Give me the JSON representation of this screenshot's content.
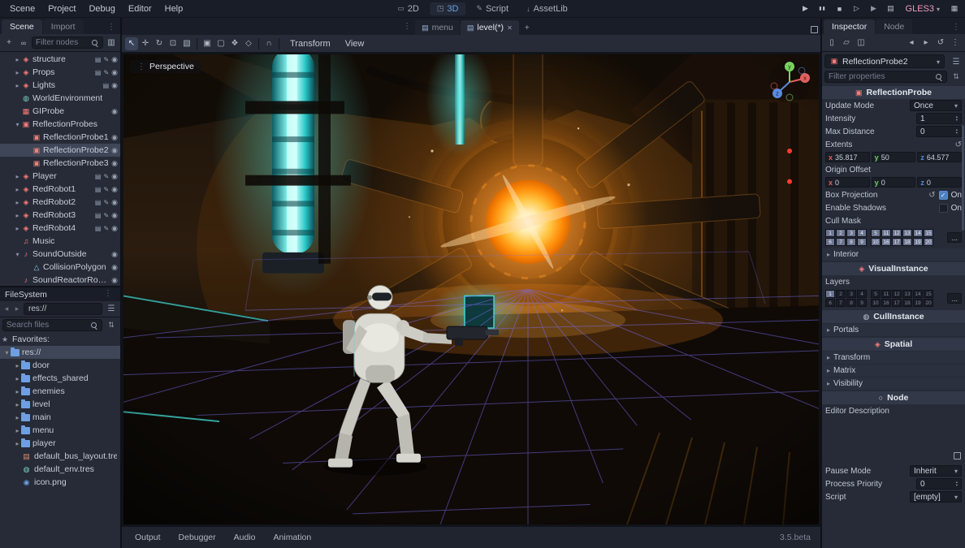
{
  "menubar": {
    "menus": [
      "Scene",
      "Project",
      "Debug",
      "Editor",
      "Help"
    ],
    "workspaces": [
      {
        "label": "2D",
        "icon": "ws-2d"
      },
      {
        "label": "3D",
        "icon": "ws-3d",
        "active": true
      },
      {
        "label": "Script",
        "icon": "ws-script"
      },
      {
        "label": "AssetLib",
        "icon": "ws-asset"
      }
    ],
    "renderer": "GLES3"
  },
  "scene_dock": {
    "tabs": [
      {
        "label": "Scene",
        "active": true
      },
      {
        "label": "Import",
        "active": false
      }
    ],
    "filter_placeholder": "Filter nodes",
    "nodes": [
      {
        "label": "structure",
        "indent": 1,
        "expand": "right",
        "icon": "ic-spatial",
        "scene_badge": true,
        "script_badge": true,
        "eye": true
      },
      {
        "label": "Props",
        "indent": 1,
        "expand": "right",
        "icon": "ic-spatial",
        "scene_badge": true,
        "script_badge": true,
        "eye": true
      },
      {
        "label": "Lights",
        "indent": 1,
        "expand": "right",
        "icon": "ic-spatial",
        "scene_badge": true,
        "eye": true
      },
      {
        "label": "WorldEnvironment",
        "indent": 1,
        "icon": "ic-world"
      },
      {
        "label": "GIProbe",
        "indent": 1,
        "icon": "ic-giprobe",
        "eye": true
      },
      {
        "label": "ReflectionProbes",
        "indent": 1,
        "expand": "down",
        "icon": "ic-probe"
      },
      {
        "label": "ReflectionProbe1",
        "indent": 2,
        "icon": "ic-probe",
        "eye": true
      },
      {
        "label": "ReflectionProbe2",
        "indent": 2,
        "icon": "ic-probe",
        "eye": true,
        "selected": true
      },
      {
        "label": "ReflectionProbe3",
        "indent": 2,
        "icon": "ic-probe",
        "eye": true
      },
      {
        "label": "Player",
        "indent": 1,
        "expand": "right",
        "icon": "ic-spatial",
        "scene_badge": true,
        "script_badge": true,
        "eye": true
      },
      {
        "label": "RedRobot1",
        "indent": 1,
        "expand": "right",
        "icon": "ic-spatial",
        "scene_badge": true,
        "script_badge": true,
        "eye": true
      },
      {
        "label": "RedRobot2",
        "indent": 1,
        "expand": "right",
        "icon": "ic-spatial",
        "scene_badge": true,
        "script_badge": true,
        "eye": true
      },
      {
        "label": "RedRobot3",
        "indent": 1,
        "expand": "right",
        "icon": "ic-spatial",
        "scene_badge": true,
        "script_badge": true,
        "eye": true
      },
      {
        "label": "RedRobot4",
        "indent": 1,
        "expand": "right",
        "icon": "ic-spatial",
        "scene_badge": true,
        "script_badge": true,
        "eye": true
      },
      {
        "label": "Music",
        "indent": 1,
        "icon": "ic-music"
      },
      {
        "label": "SoundOutside",
        "indent": 1,
        "expand": "down",
        "icon": "ic-sound",
        "eye": true
      },
      {
        "label": "CollisionPolygon",
        "indent": 2,
        "icon": "ic-collision",
        "eye": true
      },
      {
        "label": "SoundReactorRoom",
        "indent": 1,
        "icon": "ic-sound",
        "eye": true
      }
    ]
  },
  "filesystem_dock": {
    "title": "FileSystem",
    "path": "res://",
    "search_placeholder": "Search files",
    "favorites_label": "Favorites:",
    "items": [
      {
        "label": "res://",
        "icon": "ic-folder",
        "indent": 0,
        "expand": "down",
        "selected": true
      },
      {
        "label": "door",
        "icon": "ic-folder",
        "indent": 1,
        "expand": "right"
      },
      {
        "label": "effects_shared",
        "icon": "ic-folder",
        "indent": 1,
        "expand": "right"
      },
      {
        "label": "enemies",
        "icon": "ic-folder",
        "indent": 1,
        "expand": "right"
      },
      {
        "label": "level",
        "icon": "ic-folder",
        "indent": 1,
        "expand": "right"
      },
      {
        "label": "main",
        "icon": "ic-folder",
        "indent": 1,
        "expand": "right"
      },
      {
        "label": "menu",
        "icon": "ic-folder",
        "indent": 1,
        "expand": "right"
      },
      {
        "label": "player",
        "icon": "ic-folder",
        "indent": 1,
        "expand": "right"
      },
      {
        "label": "default_bus_layout.tres",
        "icon": "ic-tres",
        "indent": 1
      },
      {
        "label": "default_env.tres",
        "icon": "ic-env",
        "indent": 1
      },
      {
        "label": "icon.png",
        "icon": "ic-img",
        "indent": 1
      }
    ]
  },
  "viewport": {
    "tabs": [
      {
        "label": "menu",
        "active": false
      },
      {
        "label": "level(*)",
        "active": true
      }
    ],
    "menus": [
      "Transform",
      "View"
    ],
    "perspective_label": "Perspective",
    "gizmo": {
      "x": "x",
      "y": "y",
      "z": "z"
    },
    "bottom_tabs": [
      "Output",
      "Debugger",
      "Audio",
      "Animation"
    ],
    "version": "3.5.beta"
  },
  "inspector": {
    "tabs": [
      {
        "label": "Inspector",
        "active": true
      },
      {
        "label": "Node",
        "active": false
      }
    ],
    "node_name": "ReflectionProbe2",
    "filter_placeholder": "Filter properties",
    "more": "...",
    "axis": {
      "x": "x",
      "y": "y",
      "z": "z"
    },
    "category_probe": "ReflectionProbe",
    "update_mode": {
      "label": "Update Mode",
      "value": "Once"
    },
    "intensity": {
      "label": "Intensity",
      "value": "1"
    },
    "max_distance": {
      "label": "Max Distance",
      "value": "0"
    },
    "extents": {
      "label": "Extents",
      "x": "35.817",
      "y": "50",
      "z": "64.577"
    },
    "origin_offset": {
      "label": "Origin Offset",
      "x": "0",
      "y": "0",
      "z": "0"
    },
    "box_projection": {
      "label": "Box Projection",
      "value": "On"
    },
    "enable_shadows": {
      "label": "Enable Shadows",
      "value": "On"
    },
    "cull_mask": {
      "label": "Cull Mask"
    },
    "interior": {
      "label": "Interior"
    },
    "category_visual": "VisualInstance",
    "layers": {
      "label": "Layers"
    },
    "category_cull": "CullInstance",
    "portals": {
      "label": "Portals"
    },
    "category_spatial": "Spatial",
    "transform": {
      "label": "Transform"
    },
    "matrix": {
      "label": "Matrix"
    },
    "visibility": {
      "label": "Visibility"
    },
    "category_node": "Node",
    "editor_description": {
      "label": "Editor Description"
    },
    "pause_mode": {
      "label": "Pause Mode",
      "value": "Inherit"
    },
    "process_priority": {
      "label": "Process Priority",
      "value": "0"
    },
    "script": {
      "label": "Script",
      "value": "[empty]"
    },
    "cull_row1": [
      {
        "n": "1",
        "on": true
      },
      {
        "n": "2",
        "on": true
      },
      {
        "n": "3",
        "on": true
      },
      {
        "n": "4",
        "on": true
      },
      {
        "n": "5",
        "on": true
      },
      {
        "n": "11",
        "on": true
      },
      {
        "n": "12",
        "on": true
      },
      {
        "n": "13",
        "on": true
      },
      {
        "n": "14",
        "on": true
      },
      {
        "n": "15",
        "on": true
      }
    ],
    "cull_row2": [
      {
        "n": "6",
        "on": true
      },
      {
        "n": "7",
        "on": true
      },
      {
        "n": "8",
        "on": true
      },
      {
        "n": "9",
        "on": true
      },
      {
        "n": "10",
        "on": true
      },
      {
        "n": "16",
        "on": true
      },
      {
        "n": "17",
        "on": true
      },
      {
        "n": "18",
        "on": true
      },
      {
        "n": "19",
        "on": true
      },
      {
        "n": "20",
        "on": true
      }
    ],
    "layers_row1": [
      {
        "n": "1",
        "on": true
      },
      {
        "n": "2"
      },
      {
        "n": "3"
      },
      {
        "n": "4"
      },
      {
        "n": "5"
      },
      {
        "n": "11"
      },
      {
        "n": "12"
      },
      {
        "n": "13"
      },
      {
        "n": "14"
      },
      {
        "n": "15"
      }
    ],
    "layers_row2": [
      {
        "n": "6"
      },
      {
        "n": "7"
      },
      {
        "n": "8"
      },
      {
        "n": "9"
      },
      {
        "n": "10"
      },
      {
        "n": "16"
      },
      {
        "n": "17"
      },
      {
        "n": "18"
      },
      {
        "n": "19"
      },
      {
        "n": "20"
      }
    ]
  }
}
